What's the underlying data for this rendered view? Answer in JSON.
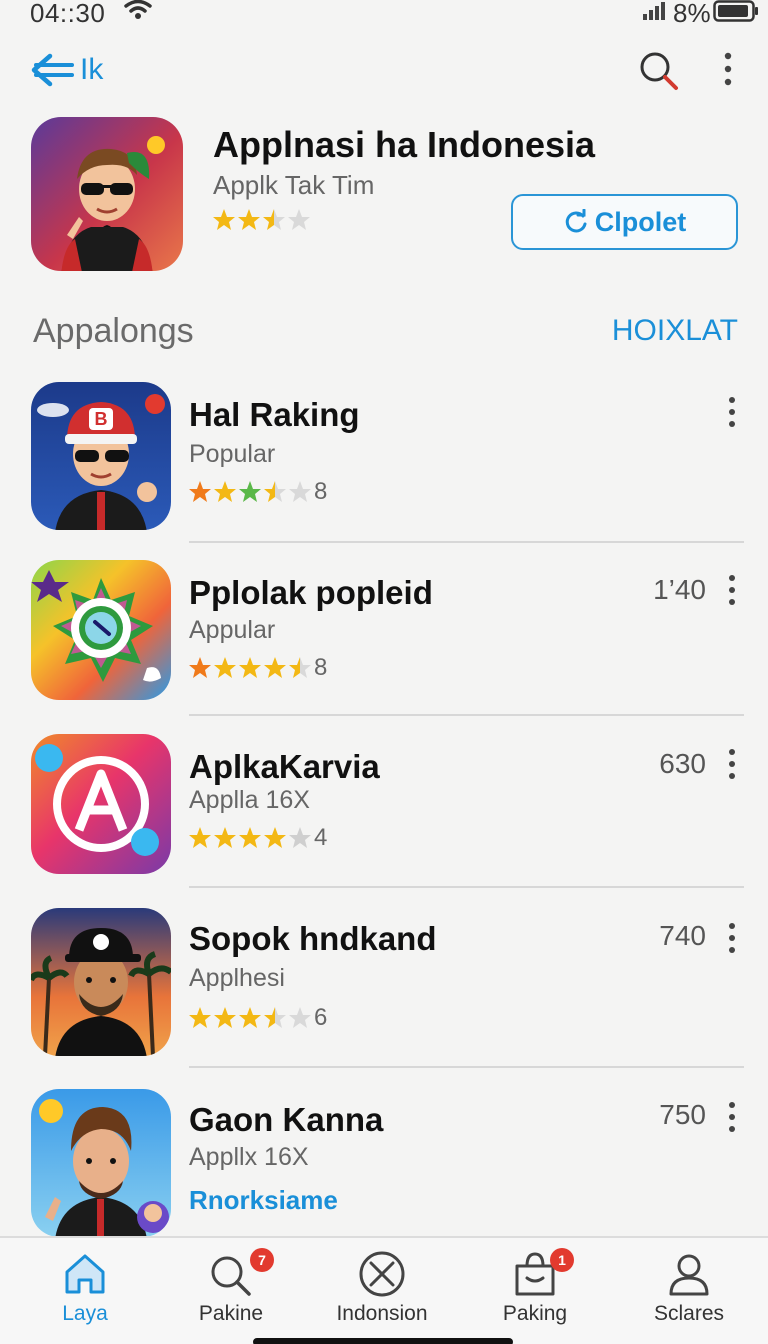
{
  "status_bar": {
    "time": "04::30",
    "battery": "8%"
  },
  "header": {
    "back_label": "Ik"
  },
  "featured": {
    "title": "Applnasi ha Indonesia",
    "subtitle": "Applk Tak Tim",
    "rating": 2.5,
    "button_label": "Clpolet"
  },
  "section": {
    "title": "Appalongs",
    "link": "HOIXLAT"
  },
  "apps": [
    {
      "name": "Hal Raking",
      "subtitle": "Popular",
      "rating_count": "8",
      "count": "",
      "rating": 3.5,
      "icon": "avatar-cap-icon"
    },
    {
      "name": "Pplolak popleid",
      "subtitle": "Appular",
      "rating_count": "8",
      "count": "1’40",
      "rating": 4.5,
      "icon": "colorful-lens-icon"
    },
    {
      "name": "AplkaKarvia",
      "subtitle": "Applla 16X",
      "rating_count": "4",
      "count": "630",
      "rating": 4,
      "icon": "letter-a-icon"
    },
    {
      "name": "Sopok hndkand",
      "subtitle": "Applhesi",
      "rating_count": "6",
      "count": "740",
      "rating": 3.5,
      "icon": "avatar-palm-icon"
    },
    {
      "name": "Gaon Kanna",
      "subtitle": "Appllx 16X",
      "link": "Rnorksiame",
      "count": "750",
      "icon": "avatar-sun-icon"
    }
  ],
  "bottom_nav": [
    {
      "label": "Laya",
      "icon": "home-icon",
      "badge": ""
    },
    {
      "label": "Pakine",
      "icon": "search-icon",
      "badge": "7"
    },
    {
      "label": "Indonsion",
      "icon": "close-circle-icon",
      "badge": ""
    },
    {
      "label": "Paking",
      "icon": "bag-icon",
      "badge": "1"
    },
    {
      "label": "Sclares",
      "icon": "user-icon",
      "badge": ""
    }
  ],
  "colors": {
    "accent": "#1a8fd8",
    "star": "#f3b814",
    "badge": "#e23a2f"
  }
}
